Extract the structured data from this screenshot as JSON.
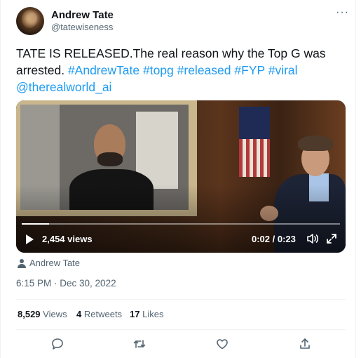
{
  "tweet": {
    "author_name": "Andrew Tate",
    "author_handle": "@tatewiseness",
    "more_label": "···",
    "text_plain": "TATE IS RELEASED.The real reason why the Top G was arrested. ",
    "hashtags": [
      "#AndrewTate",
      "#topg",
      "#released",
      "#FYP",
      "#viral"
    ],
    "mention": "@therealworld_ai"
  },
  "video": {
    "views": "2,454 views",
    "time": "0:02 / 0:23",
    "progress": 0.087,
    "attribution": "Andrew Tate"
  },
  "meta": {
    "timestamp": "6:15 PM · Dec 30, 2022"
  },
  "stats": {
    "views_count": "8,529",
    "views_label": "Views",
    "retweets_count": "4",
    "retweets_label": "Retweets",
    "likes_count": "17",
    "likes_label": "Likes"
  },
  "colors": {
    "link": "#1d9bf0",
    "secondary_text": "#536471",
    "primary_text": "#0f1419",
    "divider": "#eff3f4"
  },
  "icons": [
    "reply-icon",
    "retweet-icon",
    "like-icon",
    "share-icon",
    "play-icon",
    "volume-icon",
    "expand-icon",
    "person-icon",
    "more-icon"
  ]
}
